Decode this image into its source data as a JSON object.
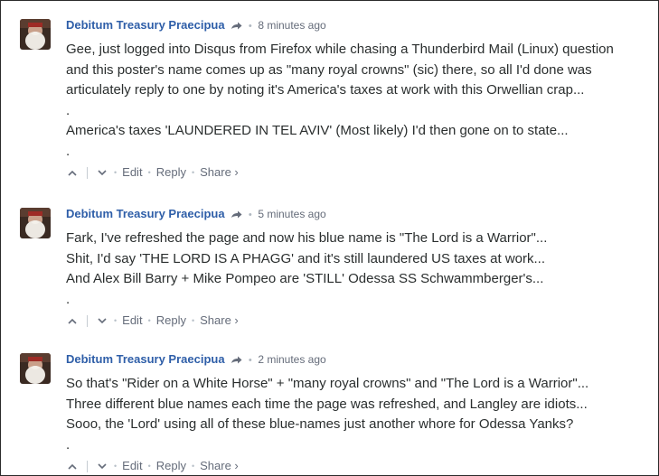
{
  "comments": [
    {
      "author": "Debitum Treasury Praecipua",
      "time": "8 minutes ago",
      "lines": [
        "Gee, just logged into Disqus from Firefox while chasing a Thunderbird Mail (Linux) question",
        "and this poster's name comes up as \"many royal crowns\" (sic) there, so all I'd done was",
        "articulately reply to one by noting it's America's taxes at work with this Orwellian crap...",
        ".",
        "America's taxes 'LAUNDERED IN TEL AVIV' (Most likely) I'd then gone on to state...",
        "."
      ],
      "actions": {
        "edit": "Edit",
        "reply": "Reply",
        "share": "Share ›"
      }
    },
    {
      "author": "Debitum Treasury Praecipua",
      "time": "5 minutes ago",
      "lines": [
        "Fark, I've refreshed the page and now his blue name is \"The Lord is a Warrior\"...",
        "Shit, I'd say 'THE LORD IS A PHAGG' and it's still laundered US taxes at work...",
        "And Alex Bill Barry + Mike Pompeo are 'STILL' Odessa SS Schwammberger's...",
        "."
      ],
      "actions": {
        "edit": "Edit",
        "reply": "Reply",
        "share": "Share ›"
      }
    },
    {
      "author": "Debitum Treasury Praecipua",
      "time": "2 minutes ago",
      "lines": [
        "So that's \"Rider on a White Horse\" + \"many royal crowns\" and \"The Lord is a Warrior\"...",
        "Three different blue names each time the page was refreshed, and Langley are idiots...",
        "Sooo, the 'Lord' using all of these blue-names just another whore for Odessa Yanks?",
        "."
      ],
      "actions": {
        "edit": "Edit",
        "reply": "Reply",
        "share": "Share ›"
      }
    }
  ],
  "colors": {
    "author": "#2e5ea8",
    "meta": "#656c7a",
    "text": "#2a2e2e"
  },
  "icons": {
    "reply_to": "arrow-right-icon",
    "upvote": "chevron-up-icon",
    "downvote": "chevron-down-icon"
  }
}
